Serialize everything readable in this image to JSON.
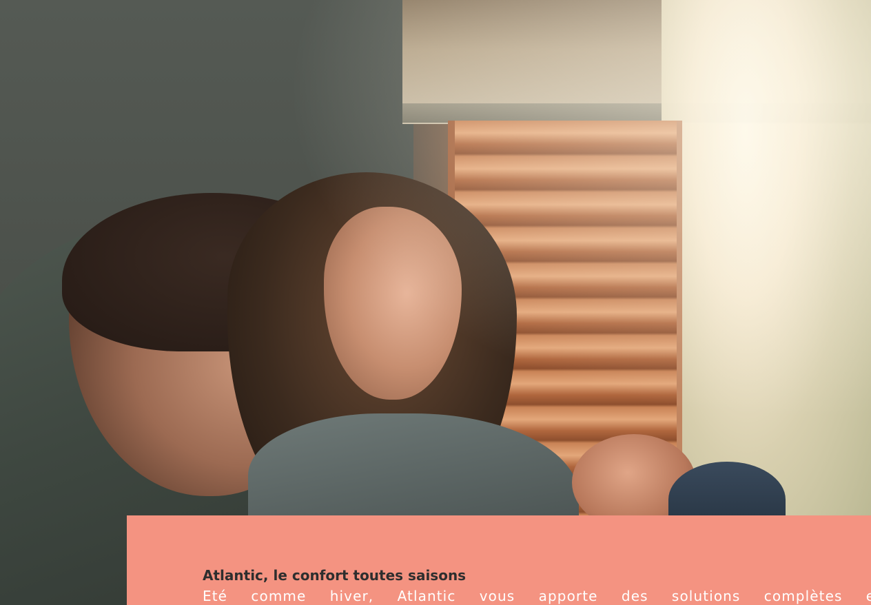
{
  "card": {
    "title": "Atlantic, le confort toutes saisons",
    "body": "Eté comme hiver, Atlantic vous apporte des solutions complètes en"
  },
  "colors": {
    "card_background": "#f49381",
    "title_text": "#2e2e2e",
    "body_text": "#ffffff"
  }
}
